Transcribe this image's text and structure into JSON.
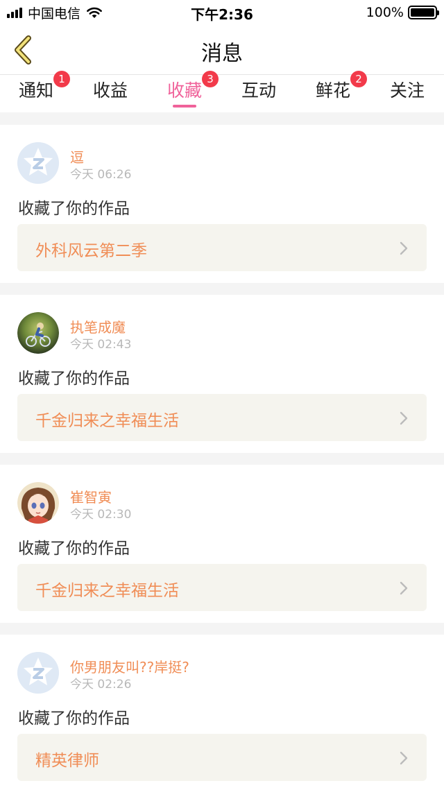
{
  "status_bar": {
    "carrier": "中国电信",
    "time": "下午2:36",
    "battery": "100%"
  },
  "nav": {
    "title": "消息",
    "back_icon": "chevron-left-icon"
  },
  "tabs": [
    {
      "label": "通知",
      "badge": "1",
      "active": false
    },
    {
      "label": "收益",
      "badge": "",
      "active": false
    },
    {
      "label": "收藏",
      "badge": "3",
      "active": true
    },
    {
      "label": "互动",
      "badge": "",
      "active": false
    },
    {
      "label": "鲜花",
      "badge": "2",
      "active": false
    },
    {
      "label": "关注",
      "badge": "",
      "active": false
    }
  ],
  "messages": [
    {
      "username": "逗",
      "time": "今天 06:26",
      "action": "收藏了你的作品",
      "work": "外科风云第二季",
      "avatar": "default-avatar-icon"
    },
    {
      "username": "执笔成魔",
      "time": "今天 02:43",
      "action": "收藏了你的作品",
      "work": "千金归来之幸福生活",
      "avatar": "photo-avatar"
    },
    {
      "username": "崔智寅",
      "time": "今天 02:30",
      "action": "收藏了你的作品",
      "work": "千金归来之幸福生活",
      "avatar": "anime-avatar"
    },
    {
      "username": "你男朋友叫??岸挺?",
      "time": "今天 02:26",
      "action": "收藏了你的作品",
      "work": "精英律师",
      "avatar": "default-avatar-icon"
    }
  ],
  "colors": {
    "accent": "#f0629a",
    "username": "#f08d56",
    "badge": "#f23a4a",
    "work_bg": "#f5f4ee"
  }
}
